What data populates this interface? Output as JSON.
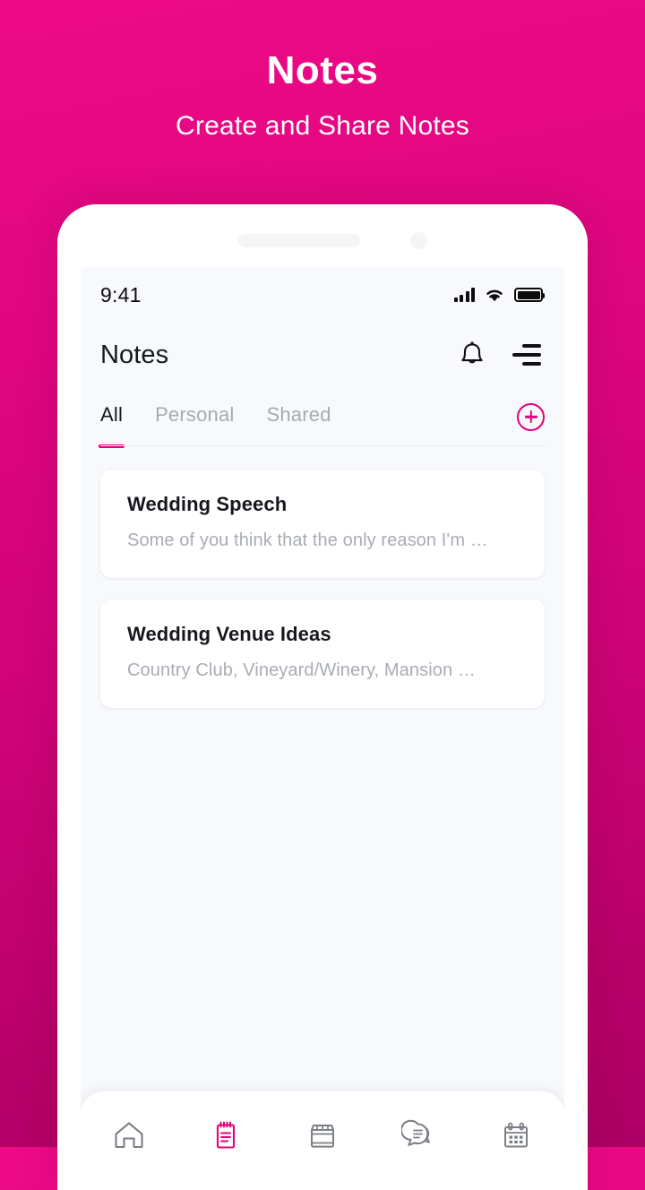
{
  "promo": {
    "title": "Notes",
    "subtitle": "Create and Share Notes"
  },
  "theme": {
    "accent": "#E4007E",
    "bg_top": "#ED0A86",
    "bg_bottom": "#AD0064",
    "screen_bg": "#F7F9FC",
    "card_bg": "#FFFFFF",
    "text_primary": "#16181D",
    "text_muted": "#A8ACB3"
  },
  "status_bar": {
    "time": "9:41",
    "signal_icon": "cellular-signal-icon",
    "wifi_icon": "wifi-icon",
    "battery_icon": "battery-full-icon"
  },
  "app_bar": {
    "title": "Notes",
    "notifications_icon": "bell-icon",
    "menu_icon": "hamburger-menu-icon"
  },
  "tabs": {
    "items": [
      {
        "label": "All",
        "active": true
      },
      {
        "label": "Personal",
        "active": false
      },
      {
        "label": "Shared",
        "active": false
      }
    ],
    "add_icon": "plus-circle-icon"
  },
  "notes": [
    {
      "title": "Wedding Speech",
      "snippet": "Some of you think that the only reason I'm …"
    },
    {
      "title": "Wedding Venue Ideas",
      "snippet": "Country Club, Vineyard/Winery, Mansion …"
    }
  ],
  "bottom_nav": [
    {
      "icon": "home-icon",
      "active": false
    },
    {
      "icon": "notepad-icon",
      "active": true
    },
    {
      "icon": "store-icon",
      "active": false
    },
    {
      "icon": "chat-bubbles-icon",
      "active": false
    },
    {
      "icon": "calendar-icon",
      "active": false
    }
  ]
}
